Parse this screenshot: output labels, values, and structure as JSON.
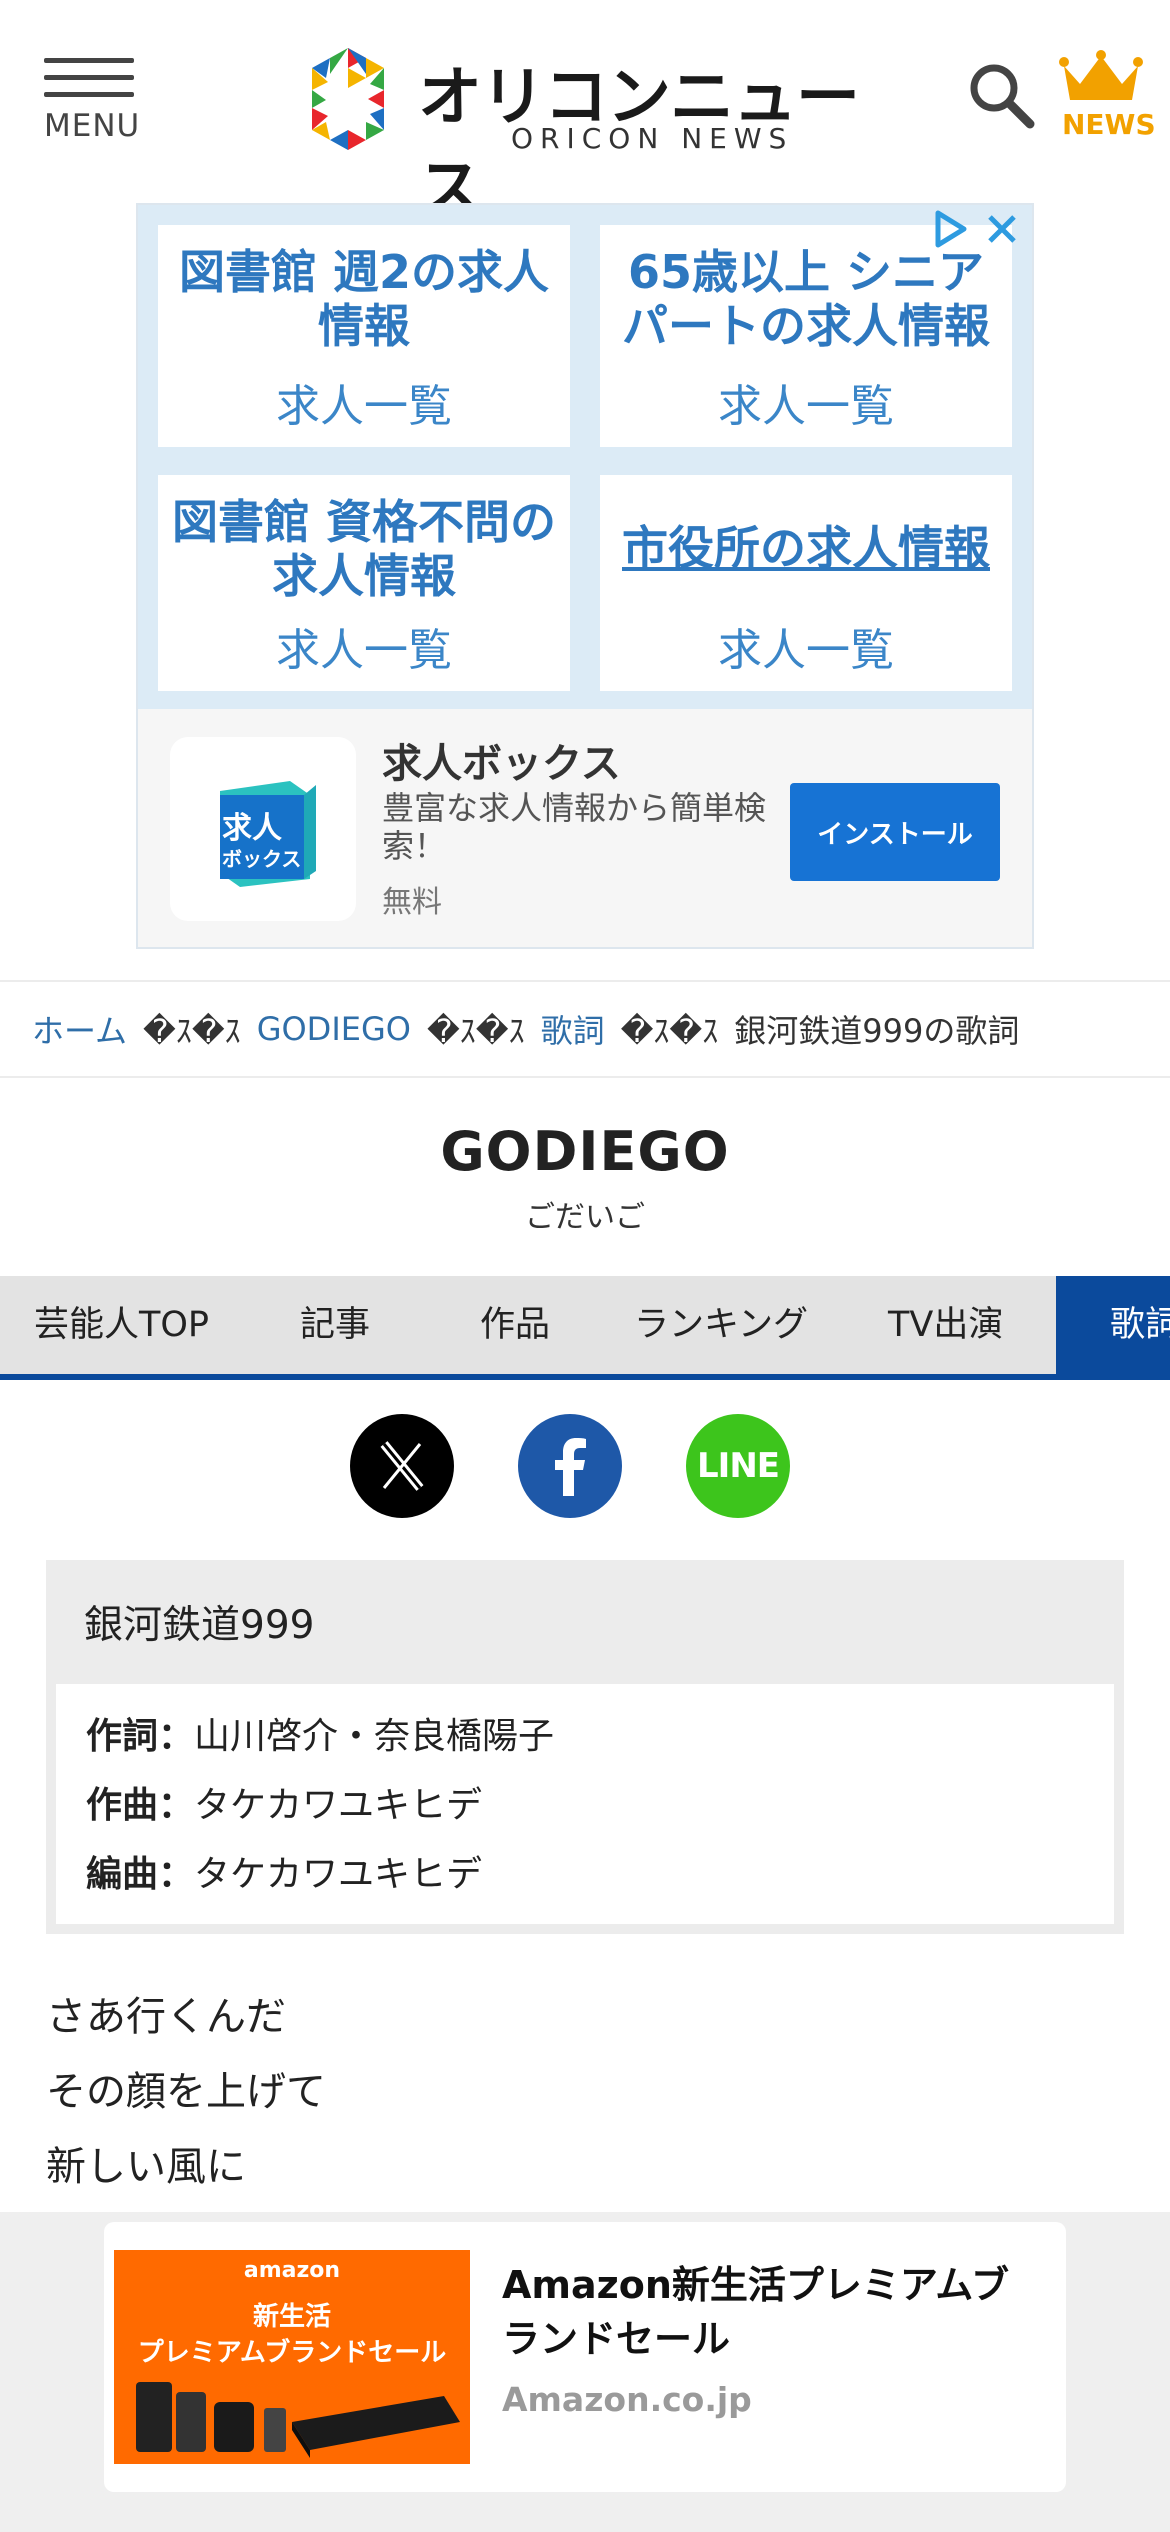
{
  "header": {
    "menu_label": "MENU",
    "logo_jp": "オリコンニュース",
    "logo_en": "ORICON NEWS",
    "news_label": "NEWS",
    "accent_color": "#f2a100"
  },
  "ad_top": {
    "cells": [
      {
        "title": "図書館 週2の求人情報",
        "subtitle": "求人一覧"
      },
      {
        "title": "65歳以上 シニアパートの求人情報",
        "subtitle": "求人一覧"
      },
      {
        "title": "図書館 資格不問の求人情報",
        "subtitle": "求人一覧"
      },
      {
        "title": "市役所の求人情報",
        "subtitle": "求人一覧"
      }
    ],
    "app": {
      "icon_text_1": "求人",
      "icon_text_2": "ボックス",
      "name": "求人ボックス",
      "description": "豊富な求人情報から簡単検索！",
      "price": "無料",
      "install_label": "インストール"
    }
  },
  "breadcrumb": {
    "separator": "�ｽ�ｽ",
    "items": [
      "ホーム",
      "GODIEGO",
      "歌詞"
    ],
    "current": "銀河鉄道999の歌詞"
  },
  "artist": {
    "name": "GODIEGO",
    "kana": "ごだいご"
  },
  "tabs": [
    {
      "label": "芸能人TOP"
    },
    {
      "label": "記事"
    },
    {
      "label": "作品"
    },
    {
      "label": "ランキング"
    },
    {
      "label": "TV出演"
    },
    {
      "label": "歌詞"
    }
  ],
  "social": {
    "line_label": "LINE"
  },
  "song": {
    "title": "銀河鉄道999",
    "credits": [
      {
        "label": "作詞：",
        "value": "山川啓介・奈良橋陽子"
      },
      {
        "label": "作曲：",
        "value": "タケカワユキヒデ"
      },
      {
        "label": "編曲：",
        "value": "タケカワユキヒデ"
      }
    ]
  },
  "lyrics": [
    "さあ行くんだ",
    "その顔を上げて",
    "新しい風に"
  ],
  "ad_bottom": {
    "banner_brand": "amazon",
    "banner_line1": "新生活",
    "banner_line2": "プレミアムブランドセール",
    "headline": "Amazon新生活プレミアムブランドセール",
    "domain": "Amazon.co.jp"
  }
}
